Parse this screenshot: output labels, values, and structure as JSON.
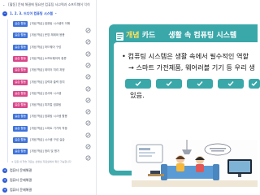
{
  "sidebar": {
    "top_title": "[활동] 문제 해결에 필요한 컴퓨팅 사고력과 소프트웨어 익히",
    "toggle_label": "1. 2. 3. 드디어 컴퓨팅 시스템",
    "lessons": [
      {
        "tag": "실습 활동",
        "color": "blue",
        "text": "[개념 학습] 컴퓨팅 시스템의 이해"
      },
      {
        "tag": "실습 활동",
        "color": "blue",
        "text": "[개념 학습] 운영 체제와 응용"
      },
      {
        "tag": "실습 활동",
        "color": "blue",
        "text": "[개념 학습] 하드웨어 구성"
      },
      {
        "tag": "실습 활동",
        "color": "pink",
        "text": "[개념 학습] 소프트웨어의 종류"
      },
      {
        "tag": "실습 활동",
        "color": "pink",
        "text": "[개념 학습] 데이터 처리 과정"
      },
      {
        "tag": "실습 활동",
        "color": "pink",
        "text": "[개념 학습] 입력과 출력 장치"
      },
      {
        "tag": "실습 활동",
        "color": "pink",
        "text": "[개념 학습] 센서와 시스템"
      },
      {
        "tag": "실습 활동",
        "color": "pink",
        "text": "[개념 학습] 피지컬 컴퓨팅"
      },
      {
        "tag": "실습 활동",
        "color": "blue",
        "text": "[개념 학습] 컴퓨팅 시스템 활용"
      },
      {
        "tag": "실습 활동",
        "color": "blue",
        "text": "[개념 학습] 스마트 기기의 작동"
      },
      {
        "tag": "실습 활동",
        "color": "blue",
        "text": "[개념 학습] 시스템 구성 실습"
      },
      {
        "tag": "실습 활동",
        "color": "blue",
        "text": "[개념 학습] 정리 및 평가"
      }
    ],
    "footer_note": "※ 단원 내 학습 자료는 선생님 자료실에서 확인 가능합니다",
    "chapters": [
      "컴퓨터 문제해결",
      "컴퓨터 문제해결",
      "컴퓨터 문제해결"
    ]
  },
  "slide": {
    "badge_prefix": "개념",
    "badge_suffix": " 카드",
    "title": "생활 속 컴퓨팅 시스템",
    "bullet": "• 컴퓨팅 시스템은 생활 속에서 필수적인 역할",
    "arrow": "→ 스마트 가전제품, 웨어러블 기기 등 우리 생",
    "last_line": "있음.",
    "checks": 5
  },
  "colors": {
    "accent": "#3aa7a9",
    "sidebar_blue": "#2b5bd7",
    "tag_pink": "#d9468a"
  }
}
